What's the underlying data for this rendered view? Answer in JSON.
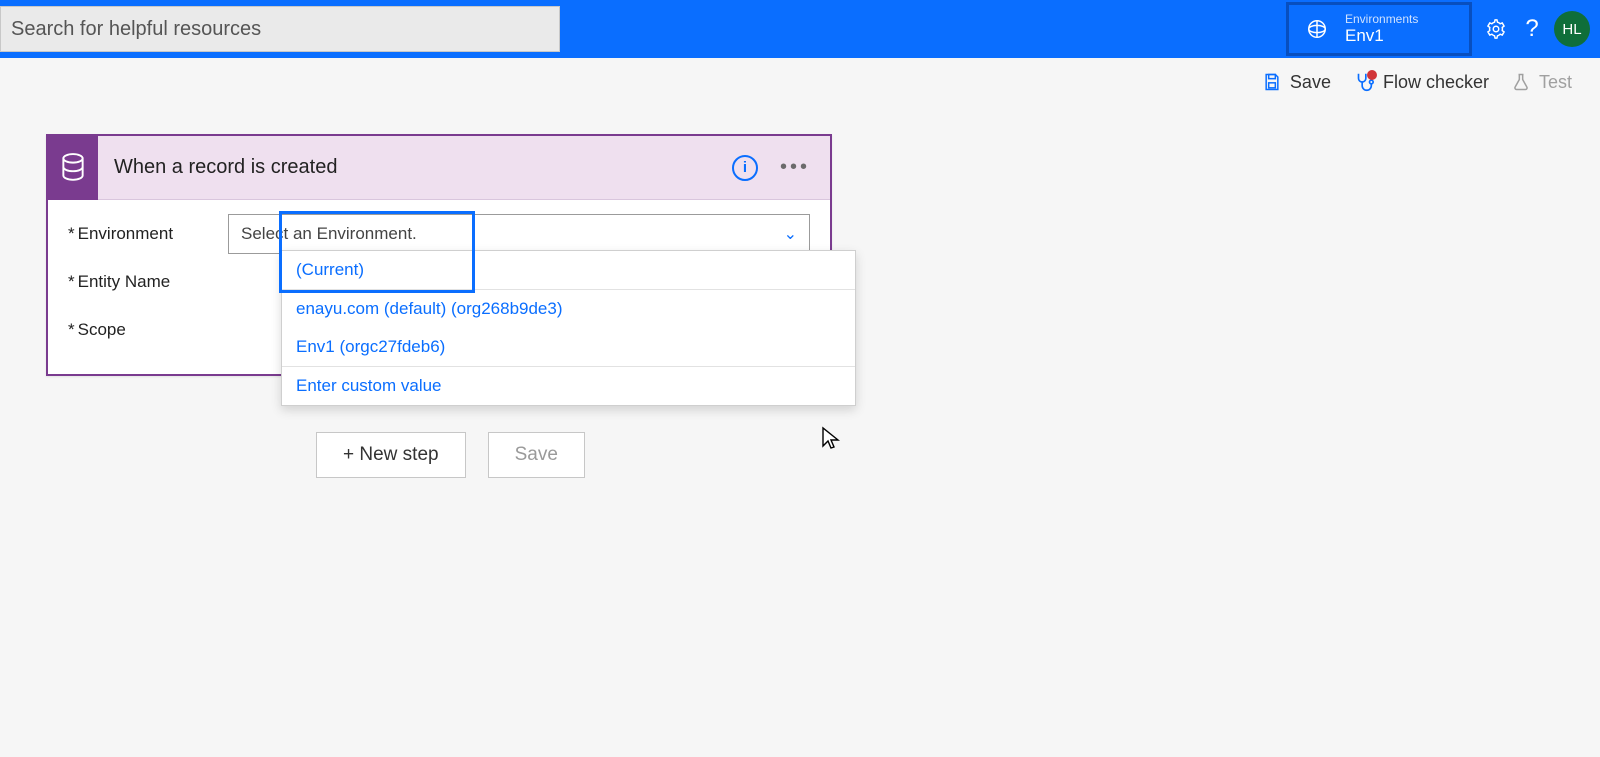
{
  "search": {
    "placeholder": "Search for helpful resources"
  },
  "header": {
    "env_label": "Environments",
    "env_name": "Env1",
    "avatar_initials": "HL"
  },
  "commands": {
    "save": "Save",
    "flow_checker": "Flow checker",
    "test": "Test"
  },
  "trigger": {
    "title": "When a record is created",
    "fields": {
      "environment_label": "Environment",
      "entity_label": "Entity Name",
      "scope_label": "Scope",
      "environment_placeholder": "Select an Environment."
    },
    "dropdown": {
      "opt_current": "(Current)",
      "opt_default": "enayu.com (default) (org268b9de3)",
      "opt_env1": "Env1 (orgc27fdeb6)",
      "opt_custom": "Enter custom value"
    }
  },
  "buttons": {
    "new_step": "+ New step",
    "save": "Save"
  }
}
